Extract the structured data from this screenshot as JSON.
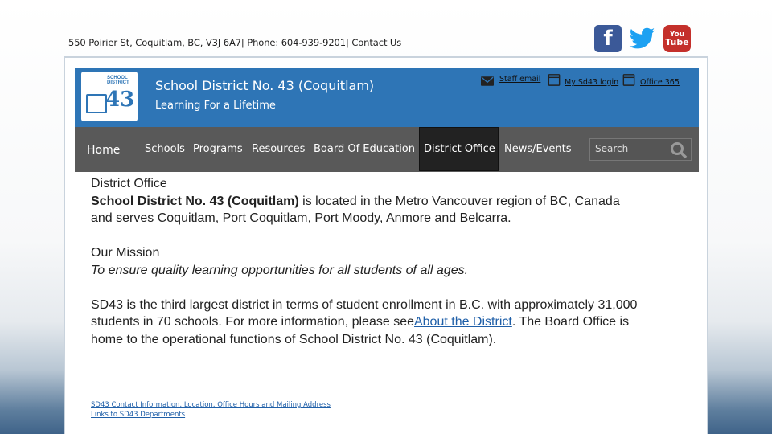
{
  "top_bar": {
    "address": "550 Poirier St, Coquitlam, BC, V3J 6A7| Phone: 604-939-9201| Contact Us"
  },
  "social": {
    "facebook_glyph": "f",
    "youtube_line1": "You",
    "youtube_line2": "Tube"
  },
  "header": {
    "logo_top_text": "SCHOOL",
    "logo_mid_text": "DISTRICT",
    "logo_number": "43",
    "title": "School District No. 43 (Coquitlam)",
    "tagline": "Learning For a Lifetime",
    "links": {
      "staff_email": "Staff email",
      "my_sd43": "My Sd43 login",
      "office_365": "Office 365"
    }
  },
  "nav": {
    "home": "Home",
    "items": [
      "Schools",
      "Programs",
      "Resources",
      "Board Of Education",
      "District Office",
      "News/Events"
    ],
    "active": "District Office",
    "search_placeholder": "Search"
  },
  "content": {
    "heading": "District Office",
    "intro_bold": "School District No. 43 (Coquitlam)",
    "intro_rest": " is located in the Metro Vancouver region of BC, Canada and serves Coquitlam, Port Coquitlam, Port Moody, Anmore and Belcarra.",
    "mission_heading": "Our Mission",
    "mission_text": "To ensure quality learning opportunities for all students of all ages.",
    "para3_a": "SD43 is the third largest district in terms of student enrollment in B.C. with approximately 31,000 students in 70 schools.  For more information, please see",
    "para3_link": "About the District",
    "para3_b": ". The Board Office is home to the operational functions of School District No. 43 (Coquitlam).",
    "link_contact": "SD43 Contact Information, Location, Office Hours and Mailing Address",
    "link_departments": "Links to SD43 Departments"
  },
  "colors": {
    "header_blue": "#2e75b6",
    "nav_gray": "#595959",
    "link_blue": "#1f5fa8"
  }
}
